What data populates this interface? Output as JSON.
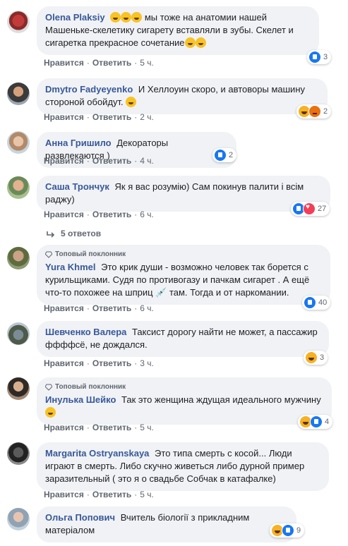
{
  "actions": {
    "like": "Нравится",
    "reply": "Ответить",
    "sep": "·"
  },
  "comments": [
    {
      "author": "Olena Plaksiy",
      "text": "мы тоже на анатомии нашей Машеньке-скелетику сигарету вставляли в зубы. Скелет и сигаретка прекрасное сочетание",
      "time": "5 ч.",
      "reactions": "3"
    },
    {
      "author": "Dmytro Fadyeyenko",
      "text": "И Хеллоуин скоро, и автоворы машину стороной обойдут.",
      "time": "2 ч.",
      "reactions": "2"
    },
    {
      "author": "Анна Гришило",
      "text": "Декораторы развлекаются )",
      "time": "4 ч.",
      "reactions": "2"
    },
    {
      "author": "Саша Трончук",
      "text": "Як я вас розумію) Сам покинув палити і всім раджу)",
      "time": "6 ч.",
      "reactions": "27",
      "replies": "5 ответов"
    },
    {
      "badge": "Топовый поклонник",
      "author": "Yura Khmel",
      "text": "Это крик души - возможно человек так борется с курильщиками. Судя по противогазу и пачкам сигарет . А ещё что-то похожее на шприц 💉 там. Тогда и от наркомании.",
      "time": "6 ч.",
      "reactions": "40"
    },
    {
      "author": "Шевченко Валера",
      "text": "Таксист дорогу найти не может, а пассажир ффффсё, не дождался.",
      "time": "3 ч.",
      "reactions": "3"
    },
    {
      "badge": "Топовый поклонник",
      "author": "Инулька Шейко",
      "text": "Так это женщина ждущая идеального мужчину",
      "time": "5 ч.",
      "reactions": "4"
    },
    {
      "author": "Margarita Ostryanskaya",
      "text": "Это типа смерть с косой... Люди играют в смерть. Либо скучно живеться либо дурной пример заразительный ( это я о свадьбе Собчак в катафалке)",
      "time": "5 ч.",
      "reactions": ""
    },
    {
      "author": "Ольга Попович",
      "text": "Вчитель біології з прикладним матеріалом",
      "time": "",
      "reactions": "9"
    }
  ]
}
